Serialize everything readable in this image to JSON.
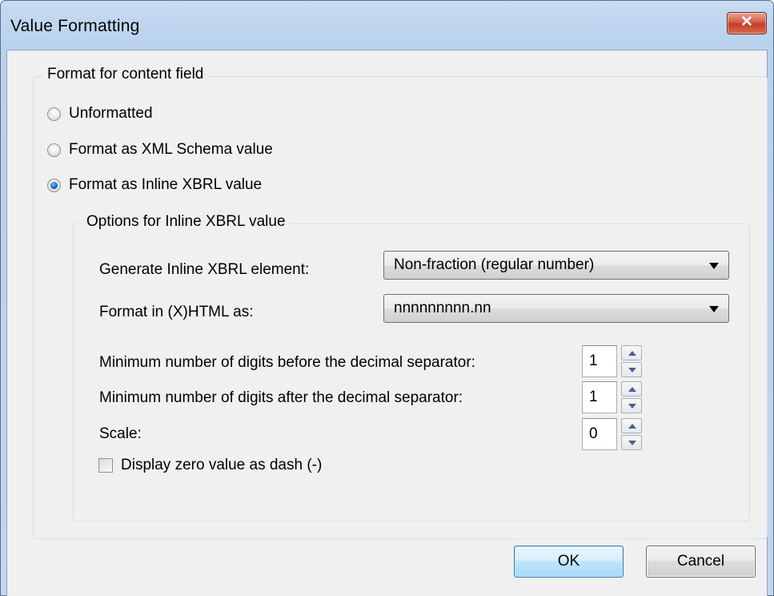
{
  "window": {
    "title": "Value Formatting",
    "close_glyph": "✕"
  },
  "format_group": {
    "legend": "Format for content field",
    "options": [
      {
        "label": "Unformatted",
        "checked": false
      },
      {
        "label": "Format as XML Schema value",
        "checked": false
      },
      {
        "label": "Format as Inline XBRL value",
        "checked": true
      }
    ]
  },
  "xbrl_group": {
    "legend": "Options for Inline XBRL value",
    "generate_label": "Generate Inline XBRL element:",
    "generate_value": "Non-fraction (regular number)",
    "format_label": "Format in (X)HTML as:",
    "format_value": "nnnnnnnnn.nn",
    "min_before_label": "Minimum number of digits before the decimal separator:",
    "min_before_value": "1",
    "min_after_label": "Minimum number of digits after the decimal separator:",
    "min_after_value": "1",
    "scale_label": "Scale:",
    "scale_value": "0",
    "dash_label": "Display zero value as dash (-)",
    "dash_checked": false
  },
  "buttons": {
    "ok": "OK",
    "cancel": "Cancel"
  },
  "icons": {
    "close": "close-icon",
    "dropdown": "chevron-down-icon",
    "spin_up": "arrow-up-icon",
    "spin_down": "arrow-down-icon"
  }
}
